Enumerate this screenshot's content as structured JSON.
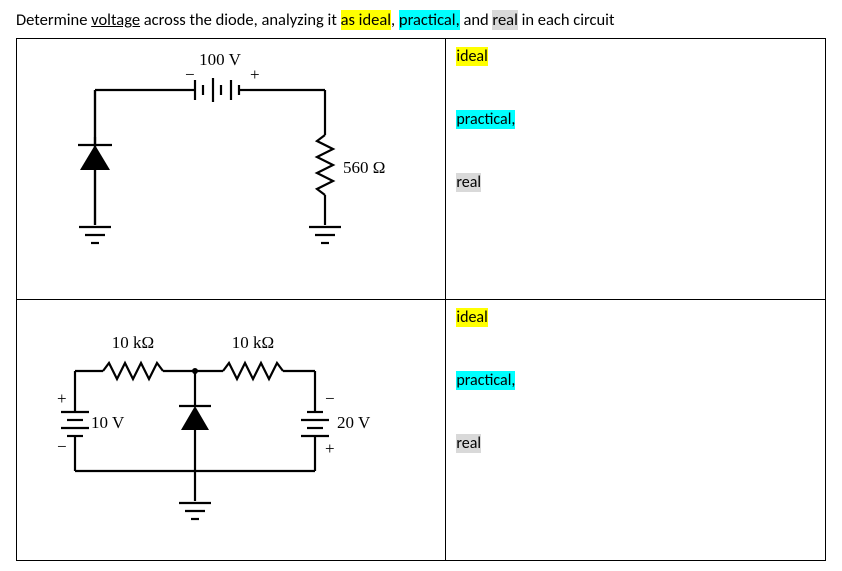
{
  "prompt": {
    "pre": "Determine ",
    "underlined": "voltage",
    "mid1": " across the diode, analyzing it ",
    "hl_ideal": "as ideal",
    "sep1": ", ",
    "hl_practical": "practical,",
    "sep2": " and ",
    "hl_real": "real",
    "post": " in each circuit"
  },
  "labels": {
    "ideal": "ideal",
    "practical": "practical,",
    "real": "real"
  },
  "circuit1": {
    "source": "100 V",
    "polarity_minus": "−",
    "polarity_plus": "+",
    "resistor": "560 Ω"
  },
  "circuit2": {
    "r1": "10 kΩ",
    "r2": "10 kΩ",
    "v1": "10 V",
    "v2": "20 V",
    "plus": "+",
    "minus": "−"
  }
}
